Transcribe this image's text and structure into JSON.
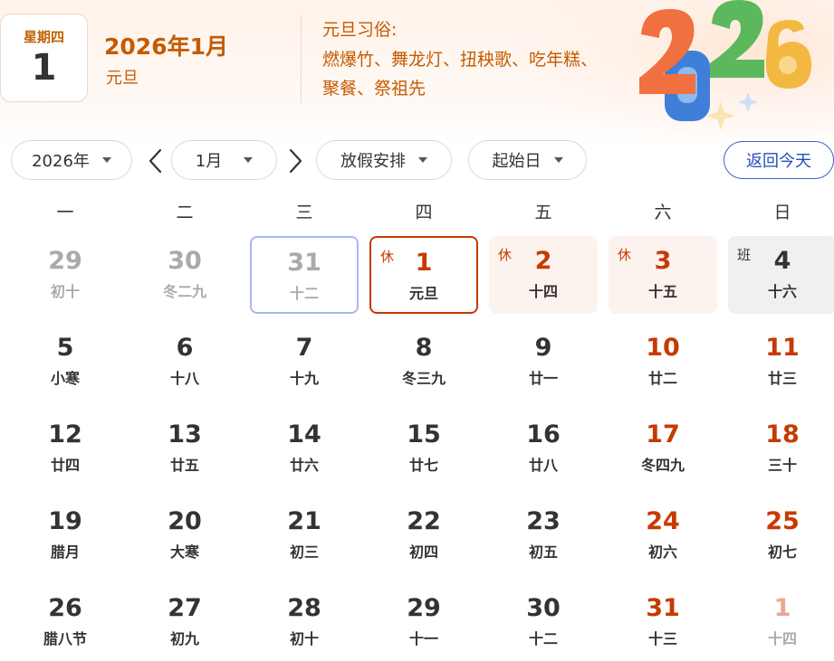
{
  "header": {
    "weekday": "星期四",
    "day": "1",
    "title": "2026年1月",
    "festival": "元旦",
    "customs_title": "元旦习俗:",
    "customs_text": "燃爆竹、舞龙灯、扭秧歌、吃年糕、聚餐、祭祖先"
  },
  "controls": {
    "year": "2026年",
    "month": "1月",
    "holiday": "放假安排",
    "start_day": "起始日",
    "today": "返回今天"
  },
  "weekdays": [
    "一",
    "二",
    "三",
    "四",
    "五",
    "六",
    "日"
  ],
  "weeks": [
    [
      {
        "n": "29",
        "l": "初十",
        "type": "other"
      },
      {
        "n": "30",
        "l": "冬二九",
        "type": "other"
      },
      {
        "n": "31",
        "l": "十二",
        "type": "other hover"
      },
      {
        "n": "1",
        "l": "元旦",
        "type": "today",
        "tag": "休"
      },
      {
        "n": "2",
        "l": "十四",
        "type": "holiday",
        "tag": "休"
      },
      {
        "n": "3",
        "l": "十五",
        "type": "holiday",
        "tag": "休"
      },
      {
        "n": "4",
        "l": "十六",
        "type": "workday",
        "tag": "班"
      }
    ],
    [
      {
        "n": "5",
        "l": "小寒",
        "type": ""
      },
      {
        "n": "6",
        "l": "十八",
        "type": ""
      },
      {
        "n": "7",
        "l": "十九",
        "type": ""
      },
      {
        "n": "8",
        "l": "冬三九",
        "type": ""
      },
      {
        "n": "9",
        "l": "廿一",
        "type": ""
      },
      {
        "n": "10",
        "l": "廿二",
        "type": "weekend"
      },
      {
        "n": "11",
        "l": "廿三",
        "type": "weekend"
      }
    ],
    [
      {
        "n": "12",
        "l": "廿四",
        "type": ""
      },
      {
        "n": "13",
        "l": "廿五",
        "type": ""
      },
      {
        "n": "14",
        "l": "廿六",
        "type": ""
      },
      {
        "n": "15",
        "l": "廿七",
        "type": ""
      },
      {
        "n": "16",
        "l": "廿八",
        "type": ""
      },
      {
        "n": "17",
        "l": "冬四九",
        "type": "weekend"
      },
      {
        "n": "18",
        "l": "三十",
        "type": "weekend"
      }
    ],
    [
      {
        "n": "19",
        "l": "腊月",
        "type": ""
      },
      {
        "n": "20",
        "l": "大寒",
        "type": ""
      },
      {
        "n": "21",
        "l": "初三",
        "type": ""
      },
      {
        "n": "22",
        "l": "初四",
        "type": ""
      },
      {
        "n": "23",
        "l": "初五",
        "type": ""
      },
      {
        "n": "24",
        "l": "初六",
        "type": "weekend"
      },
      {
        "n": "25",
        "l": "初七",
        "type": "weekend"
      }
    ],
    [
      {
        "n": "26",
        "l": "腊八节",
        "type": ""
      },
      {
        "n": "27",
        "l": "初九",
        "type": ""
      },
      {
        "n": "28",
        "l": "初十",
        "type": ""
      },
      {
        "n": "29",
        "l": "十一",
        "type": ""
      },
      {
        "n": "30",
        "l": "十二",
        "type": ""
      },
      {
        "n": "31",
        "l": "十三",
        "type": "weekend"
      },
      {
        "n": "1",
        "l": "十四",
        "type": "other-next"
      }
    ]
  ],
  "colors": {
    "accent": "#c63a00",
    "header_text": "#c65a00",
    "link_blue": "#2450b8",
    "hover_border": "#aab8ee"
  },
  "icons": {
    "prev": "chevron-left-icon",
    "next": "chevron-right-icon",
    "dropdown": "caret-down-icon",
    "art": "new-year-2026-art"
  }
}
